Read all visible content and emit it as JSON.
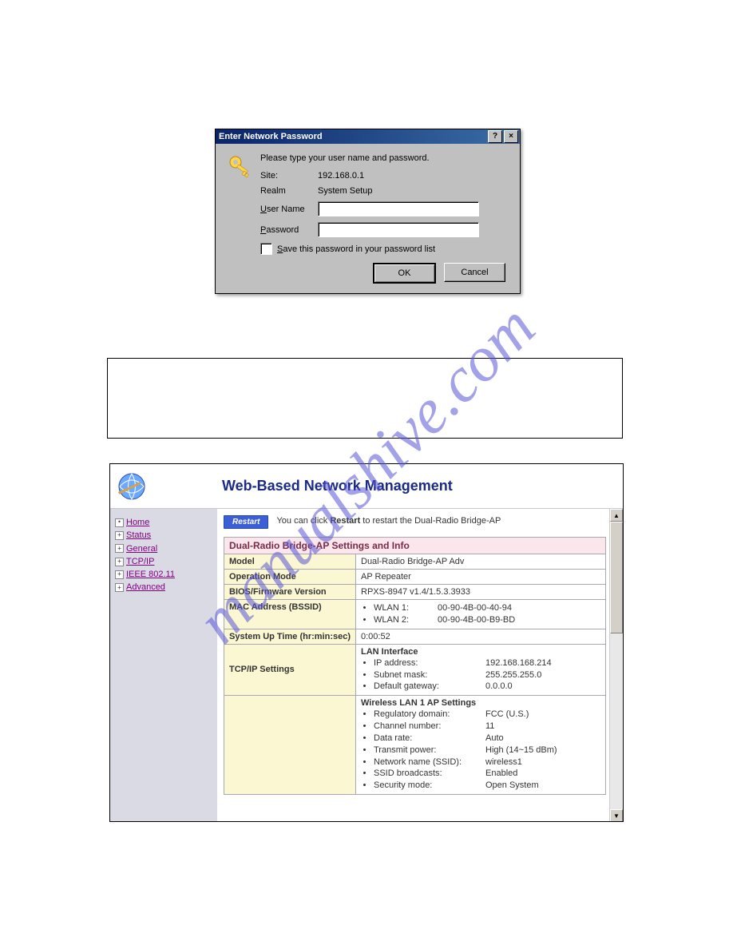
{
  "dialog": {
    "title": "Enter Network Password",
    "help_glyph": "?",
    "close_glyph": "×",
    "prompt": "Please type your user name and password.",
    "site_label": "Site:",
    "site_value": "192.168.0.1",
    "realm_label": "Realm",
    "realm_value": "System Setup",
    "username_label_pre": "U",
    "username_label_rest": "ser Name",
    "password_label_pre": "P",
    "password_label_rest": "assword",
    "save_label_pre": "S",
    "save_label_rest": "ave this password in your password list",
    "ok_label": "OK",
    "cancel_label": "Cancel"
  },
  "watermark": "manualshive.com",
  "panel": {
    "title": "Web-Based Network Management",
    "sidebar": {
      "items": [
        {
          "glyph": "•",
          "label": "Home"
        },
        {
          "glyph": "+",
          "label": "Status"
        },
        {
          "glyph": "+",
          "label": "General"
        },
        {
          "glyph": "+",
          "label": "TCP/IP"
        },
        {
          "glyph": "+",
          "label": "IEEE 802.11"
        },
        {
          "glyph": "+",
          "label": "Advanced"
        }
      ]
    },
    "restart": {
      "button": "Restart",
      "text_before": "You can click ",
      "text_bold": "Restart",
      "text_after": " to restart the Dual-Radio Bridge-AP"
    },
    "table": {
      "title": "Dual-Radio Bridge-AP Settings and Info",
      "rows": {
        "model_label": "Model",
        "model_value": "Dual-Radio Bridge-AP Adv",
        "opmode_label": "Operation Mode",
        "opmode_value": "AP Repeater",
        "bios_label": "BIOS/Firmware Version",
        "bios_value": "RPXS-8947 v1.4/1.5.3.3933",
        "mac_label": "MAC Address (BSSID)",
        "mac_wlan1_k": "WLAN 1:",
        "mac_wlan1_v": "00-90-4B-00-40-94",
        "mac_wlan2_k": "WLAN 2:",
        "mac_wlan2_v": "00-90-4B-00-B9-BD",
        "uptime_label": "System Up Time (hr:min:sec)",
        "uptime_value": "0:00:52",
        "tcpip_label": "TCP/IP Settings",
        "lan_head": "LAN Interface",
        "lan_ip_k": "IP address:",
        "lan_ip_v": "192.168.168.214",
        "lan_mask_k": "Subnet mask:",
        "lan_mask_v": "255.255.255.0",
        "lan_gw_k": "Default gateway:",
        "lan_gw_v": "0.0.0.0",
        "wlan1_head": "Wireless LAN 1 AP Settings",
        "reg_k": "Regulatory domain:",
        "reg_v": "FCC (U.S.)",
        "chan_k": "Channel number:",
        "chan_v": "11",
        "rate_k": "Data rate:",
        "rate_v": "Auto",
        "tx_k": "Transmit power:",
        "tx_v": "High (14~15 dBm)",
        "ssid_k": "Network name (SSID):",
        "ssid_v": "wireless1",
        "bcast_k": "SSID broadcasts:",
        "bcast_v": "Enabled",
        "sec_k": "Security mode:",
        "sec_v": "Open System"
      }
    }
  }
}
